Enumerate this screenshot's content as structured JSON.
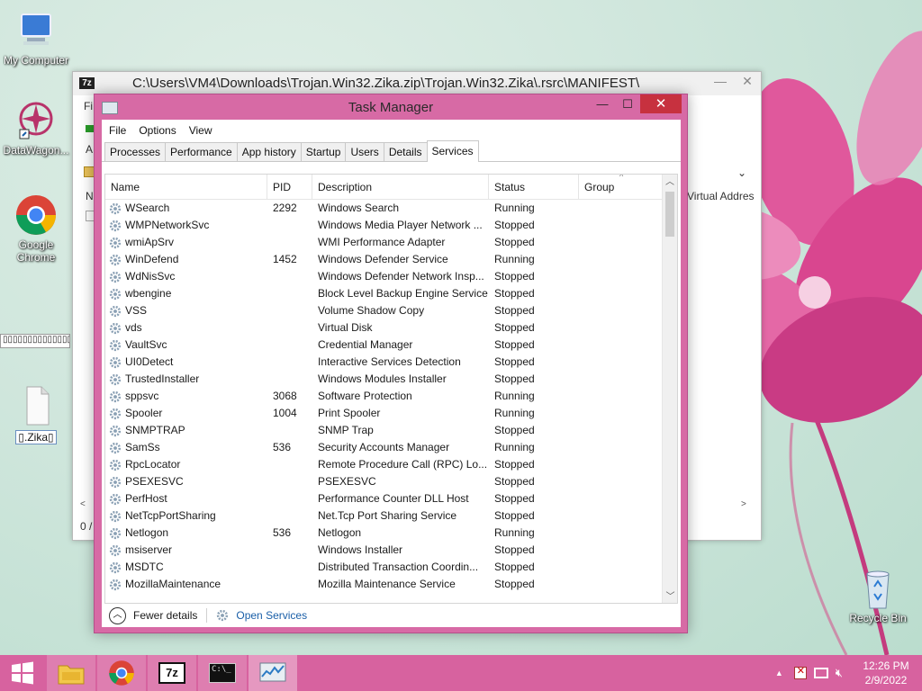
{
  "desktop": {
    "icons": [
      {
        "label": "My Computer"
      },
      {
        "label": "DataWagon..."
      },
      {
        "label": "Google Chrome"
      },
      {
        "label": "▯▯▯▯▯▯▯▯▯▯▯▯▯▯▯▯"
      },
      {
        "label": "▯.Zika▯"
      },
      {
        "label": "Recycle Bin"
      }
    ]
  },
  "zip_window": {
    "title": "C:\\Users\\VM4\\Downloads\\Trojan.Win32.Zika.zip\\Trojan.Win32.Zika\\.rsrc\\MANIFEST\\",
    "menu_first": "Fi",
    "letter_a": "A",
    "col_n": "N",
    "col_virtual": "Virtual Addres",
    "status_text": "0 /"
  },
  "task_manager": {
    "title": "Task Manager",
    "menu": [
      "File",
      "Options",
      "View"
    ],
    "tabs": [
      "Processes",
      "Performance",
      "App history",
      "Startup",
      "Users",
      "Details",
      "Services"
    ],
    "active_tab": "Services",
    "columns": {
      "name": "Name",
      "pid": "PID",
      "description": "Description",
      "status": "Status",
      "group": "Group"
    },
    "services": [
      {
        "name": "WSearch",
        "pid": "2292",
        "description": "Windows Search",
        "status": "Running"
      },
      {
        "name": "WMPNetworkSvc",
        "pid": "",
        "description": "Windows Media Player Network ...",
        "status": "Stopped"
      },
      {
        "name": "wmiApSrv",
        "pid": "",
        "description": "WMI Performance Adapter",
        "status": "Stopped"
      },
      {
        "name": "WinDefend",
        "pid": "1452",
        "description": "Windows Defender Service",
        "status": "Running"
      },
      {
        "name": "WdNisSvc",
        "pid": "",
        "description": "Windows Defender Network Insp...",
        "status": "Stopped"
      },
      {
        "name": "wbengine",
        "pid": "",
        "description": "Block Level Backup Engine Service",
        "status": "Stopped"
      },
      {
        "name": "VSS",
        "pid": "",
        "description": "Volume Shadow Copy",
        "status": "Stopped"
      },
      {
        "name": "vds",
        "pid": "",
        "description": "Virtual Disk",
        "status": "Stopped"
      },
      {
        "name": "VaultSvc",
        "pid": "",
        "description": "Credential Manager",
        "status": "Stopped"
      },
      {
        "name": "UI0Detect",
        "pid": "",
        "description": "Interactive Services Detection",
        "status": "Stopped"
      },
      {
        "name": "TrustedInstaller",
        "pid": "",
        "description": "Windows Modules Installer",
        "status": "Stopped"
      },
      {
        "name": "sppsvc",
        "pid": "3068",
        "description": "Software Protection",
        "status": "Running"
      },
      {
        "name": "Spooler",
        "pid": "1004",
        "description": "Print Spooler",
        "status": "Running"
      },
      {
        "name": "SNMPTRAP",
        "pid": "",
        "description": "SNMP Trap",
        "status": "Stopped"
      },
      {
        "name": "SamSs",
        "pid": "536",
        "description": "Security Accounts Manager",
        "status": "Running"
      },
      {
        "name": "RpcLocator",
        "pid": "",
        "description": "Remote Procedure Call (RPC) Lo...",
        "status": "Stopped"
      },
      {
        "name": "PSEXESVC",
        "pid": "",
        "description": "PSEXESVC",
        "status": "Stopped"
      },
      {
        "name": "PerfHost",
        "pid": "",
        "description": "Performance Counter DLL Host",
        "status": "Stopped"
      },
      {
        "name": "NetTcpPortSharing",
        "pid": "",
        "description": "Net.Tcp Port Sharing Service",
        "status": "Stopped"
      },
      {
        "name": "Netlogon",
        "pid": "536",
        "description": "Netlogon",
        "status": "Running"
      },
      {
        "name": "msiserver",
        "pid": "",
        "description": "Windows Installer",
        "status": "Stopped"
      },
      {
        "name": "MSDTC",
        "pid": "",
        "description": "Distributed Transaction Coordin...",
        "status": "Stopped"
      },
      {
        "name": "MozillaMaintenance",
        "pid": "",
        "description": "Mozilla Maintenance Service",
        "status": "Stopped"
      }
    ],
    "footer": {
      "fewer_details": "Fewer details",
      "open_services": "Open Services"
    }
  },
  "taskbar": {
    "apps": [
      "Windows Explorer",
      "Google Chrome",
      "7-Zip",
      "Command Prompt",
      "Task Manager"
    ],
    "clock_time": "12:26 PM",
    "clock_date": "2/9/2022"
  },
  "colors": {
    "accent": "#d76aa5",
    "taskbar": "#d7629f",
    "close": "#c7313f",
    "link": "#1a5fa8"
  }
}
